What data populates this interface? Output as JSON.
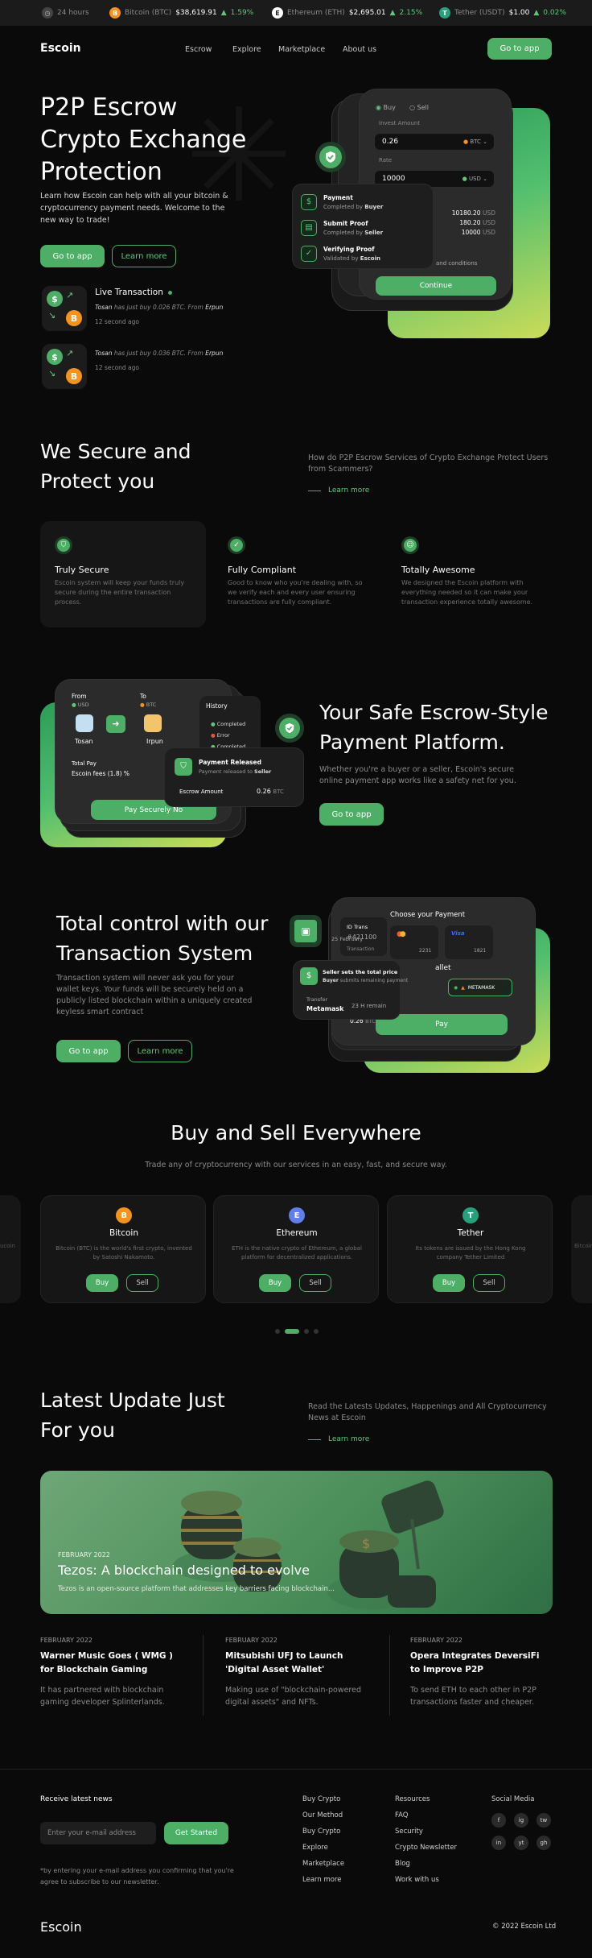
{
  "ticker": {
    "volume_label": "24 hours",
    "coins": [
      {
        "name": "Bitcoin (BTC)",
        "price": "$38,619.91",
        "change": "1.59%",
        "symbol": "B",
        "color": "#f7931a"
      },
      {
        "name": "Ethereum (ETH)",
        "price": "$2,695.01",
        "change": "2.15%",
        "symbol": "E",
        "color": "#ffffff"
      },
      {
        "name": "Tether (USDT)",
        "price": "$1.00",
        "change": "0.02%",
        "symbol": "T",
        "color": "#26a17b"
      }
    ]
  },
  "nav": {
    "logo": "Escoin",
    "links": [
      "Escrow",
      "Explore",
      "Marketplace",
      "About us"
    ],
    "cta": "Go to app"
  },
  "hero": {
    "title": "P2P Escrow Crypto Exchange Protection",
    "subtitle": "Learn how Escoin can help with all your bitcoin & cryptocurrency payment needs. Welcome to the new way to trade!",
    "primary": "Go to app",
    "secondary": "Learn more",
    "live_label": "Live Transaction",
    "transactions": [
      {
        "user": "Tosan",
        "text": "has just buy 0.026 BTC. From",
        "from": "Erpun",
        "time": "12 second ago"
      },
      {
        "user": "Tosan",
        "text": "has just buy 0.036 BTC. From",
        "from": "Erpun",
        "time": "12 second ago"
      }
    ],
    "widget": {
      "buy": "Buy",
      "sell": "Sell",
      "invest_label": "Invest Amount",
      "amount": "0.26",
      "amount_coin": "BTC",
      "rate_label": "Rate",
      "rate": "10000",
      "rate_cur": "USD",
      "values": [
        "10180.20",
        "180.20",
        "10000"
      ],
      "unit": "USD",
      "terms": "and conditions",
      "continue": "Continue"
    },
    "steps": [
      {
        "title": "Payment",
        "sub": "Completed by",
        "who": "Buyer"
      },
      {
        "title": "Submit Proof",
        "sub": "Completed by",
        "who": "Seller"
      },
      {
        "title": "Verifying Proof",
        "sub": "Validated by",
        "who": "Escoin"
      }
    ]
  },
  "secure": {
    "title": "We Secure and Protect you",
    "question": "How do P2P Escrow Services of Crypto Exchange Protect Users from Scammers?",
    "learn": "Learn more",
    "features": [
      {
        "title": "Truly Secure",
        "desc": "Escoin system will keep your funds truly secure during the entire transaction process."
      },
      {
        "title": "Fully Compliant",
        "desc": "Good to know who you're dealing with, so we verify each and every user ensuring transactions are fully compliant."
      },
      {
        "title": "Totally Awesome",
        "desc": "We designed the Escoin platform with everything needed so it can make your transaction experience totally awesome."
      }
    ]
  },
  "escrow": {
    "title": "Your Safe Escrow-Style Payment Platform.",
    "desc": "Whether you're a buyer or a seller, Escoin's secure online payment app works like a safety net for you.",
    "cta": "Go to app",
    "widget": {
      "from": "From",
      "to": "To",
      "cur": "USD",
      "cur2": "BTC",
      "from_name": "Tosan",
      "to_name": "Irpun",
      "history": "History",
      "history_items": [
        "Completed",
        "Error",
        "Completed"
      ],
      "total_label": "Total Pay",
      "fees": "Escoin fees (1.8) %",
      "released_title": "Payment Released",
      "released_sub": "Payment released to",
      "released_who": "Seller",
      "escrow_label": "Escrow Amount",
      "escrow_val": "0.26",
      "escrow_cur": "BTC",
      "pay_btn": "Pay Securely No"
    }
  },
  "control": {
    "title": "Total control with our Transaction System",
    "desc": "Transaction system will never ask you for your wallet keys. Your funds will be securely held on a publicly listed blockchain within a uniquely created keyless smart contract",
    "primary": "Go to app",
    "secondary": "Learn more",
    "widget": {
      "choose": "Choose your Payment",
      "id_label": "ID Trans",
      "id": "#421100",
      "date_label": "Transaction",
      "date": "25 February",
      "card_exp": "2231",
      "visa": "Visa",
      "visa_exp": "1821",
      "wallet": "allet",
      "metamask": "METAMASK",
      "notice_title": "Seller sets the total price",
      "notice_who": "Buyer",
      "notice_sub": "submits remaining payment",
      "transfer_label": "Transfer",
      "transfer_val": "Metamask",
      "remain": "23 H remain",
      "pay": "Pay",
      "amount": "0.26",
      "amount_cur": "BTC"
    }
  },
  "trade": {
    "title": "Buy and Sell Everywhere",
    "subtitle": "Trade any of cryptocurrency with our services in an easy, fast, and secure way.",
    "edge_left": "ucoin",
    "edge_right": "Bitcoin",
    "cards": [
      {
        "name": "Bitcoin",
        "desc": "Bitcoin (BTC) is the world's first crypto, invented by Satoshi Nakamoto.",
        "buy": "Buy",
        "sell": "Sell",
        "symbol": "B",
        "color": "#f7931a"
      },
      {
        "name": "Ethereum",
        "desc": "ETH is the native crypto of Ethereum, a global platform for decentralized applications.",
        "buy": "Buy",
        "sell": "Sell",
        "symbol": "E",
        "color": "#627eea"
      },
      {
        "name": "Tether",
        "desc": "Its tokens are issued by the Hong Kong company Tether Limited",
        "buy": "Buy",
        "sell": "Sell",
        "symbol": "T",
        "color": "#26a17b"
      }
    ]
  },
  "news": {
    "title": "Latest Update Just For you",
    "desc": "Read the Latests Updates, Happenings and All Cryptocurrency News at Escoin",
    "learn": "Learn more",
    "featured": {
      "date": "FEBRUARY 2022",
      "title": "Tezos: A blockchain designed to evolve",
      "desc": "Tezos is an open-source platform that addresses key barriers facing blockchain..."
    },
    "items": [
      {
        "date": "FEBRUARY 2022",
        "title": "Warner Music Goes ( WMG ) for Blockchain Gaming",
        "desc": "It has partnered with blockchain gaming developer Splinterlands."
      },
      {
        "date": "FEBRUARY 2022",
        "title": "Mitsubishi UFJ to Launch 'Digital Asset Wallet'",
        "desc": "Making use of \"blockchain-powered digital assets\" and NFTs."
      },
      {
        "date": "FEBRUARY 2022",
        "title": "Opera Integrates DeversiFi to Improve P2P",
        "desc": "To send ETH to each other in P2P transactions faster and cheaper."
      }
    ]
  },
  "footer": {
    "receive": "Receive latest news",
    "email_placeholder": "Enter your e-mail address",
    "start": "Get Started",
    "consent": "*by entering your e-mail address you confirming that you're agree to subscribe to our newsletter.",
    "col1": [
      "Buy Crypto",
      "Our Method",
      "Buy Crypto",
      "Explore",
      "Marketplace",
      "Learn more"
    ],
    "col2": [
      "Resources",
      "FAQ",
      "Security",
      "Crypto Newsletter",
      "Blog",
      "Work with us"
    ],
    "social_label": "Social Media",
    "social": [
      "f",
      "ig",
      "tw",
      "in",
      "yt",
      "gh"
    ],
    "logo": "Escoin",
    "copyright": "© 2022 Escoin Ltd"
  }
}
